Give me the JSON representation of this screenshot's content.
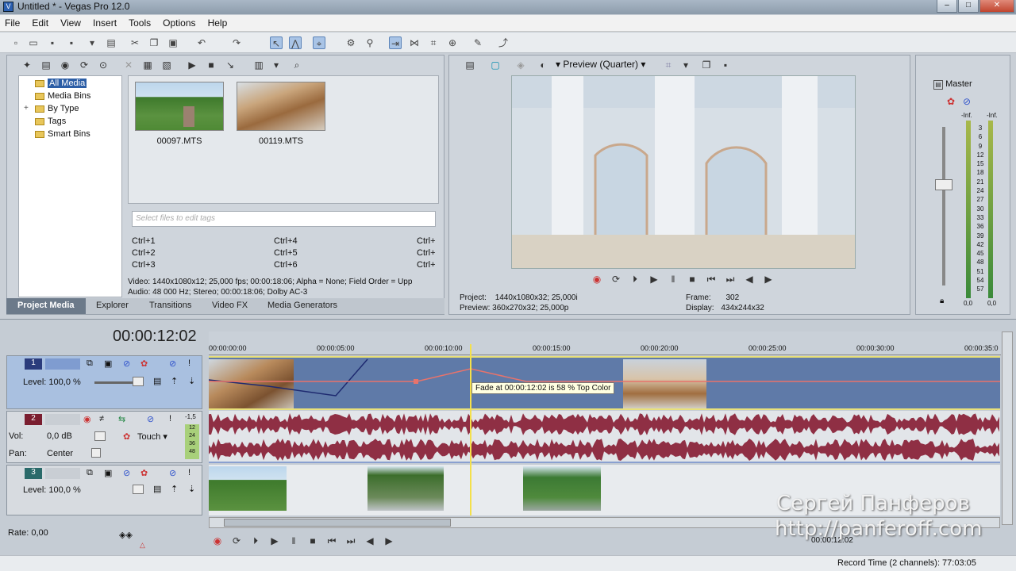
{
  "window": {
    "title": "Untitled * - Vegas Pro 12.0",
    "app_icon": "V",
    "min": "–",
    "max": "□",
    "close": "✕"
  },
  "menu": [
    "File",
    "Edit",
    "View",
    "Insert",
    "Tools",
    "Options",
    "Help"
  ],
  "explorer": {
    "tree": [
      "All Media",
      "Media Bins",
      "By Type",
      "Tags",
      "Smart Bins"
    ],
    "tree_expander": "+",
    "media": [
      {
        "name": "00097.MTS"
      },
      {
        "name": "00119.MTS"
      }
    ],
    "tags_placeholder": "Select files to edit tags",
    "shortcuts": [
      [
        "Ctrl+1",
        "Ctrl+4",
        "Ctrl+"
      ],
      [
        "Ctrl+2",
        "Ctrl+5",
        "Ctrl+"
      ],
      [
        "Ctrl+3",
        "Ctrl+6",
        "Ctrl+"
      ]
    ],
    "info1": "Video: 1440x1080x12; 25,000 fps; 00:00:18:06; Alpha = None; Field Order = Upp",
    "info2": "Audio: 48 000 Hz; Stereo; 00:00:18:06; Dolby AC-3",
    "tabs": [
      "Project Media",
      "Explorer",
      "Transitions",
      "Video FX",
      "Media Generators"
    ]
  },
  "preview": {
    "mode": "Preview (Quarter)",
    "project_label": "Project:",
    "project_value": "1440x1080x32; 25,000i",
    "preview_label": "Preview:",
    "preview_value": "360x270x32; 25,000p",
    "frame_label": "Frame:",
    "frame_value": "302",
    "display_label": "Display:",
    "display_value": "434x244x32"
  },
  "master": {
    "label": "Master",
    "inf_left": "-Inf.",
    "inf_right": "-Inf.",
    "scale": [
      "3",
      "6",
      "9",
      "12",
      "15",
      "18",
      "21",
      "24",
      "27",
      "30",
      "33",
      "36",
      "39",
      "42",
      "45",
      "48",
      "51",
      "54",
      "57"
    ],
    "bottom_left": "0,0",
    "bottom_right": "0,0"
  },
  "timeline": {
    "timecode": "00:00:12:02",
    "ruler": [
      "00:00:00:00",
      "00:00:05:00",
      "00:00:10:00",
      "00:00:15:00",
      "00:00:20:00",
      "00:00:25:00",
      "00:00:30:00",
      "00:00:35:0"
    ],
    "tooltip": "Fade at 00:00:12:02 is 58 % Top Color",
    "tracks": [
      {
        "num": "1",
        "level": "Level: 100,0 %"
      },
      {
        "num": "2",
        "vol_label": "Vol:",
        "vol": "0,0 dB",
        "pan_label": "Pan:",
        "pan": "Center",
        "mode": "Touch",
        "meter_top": "-1,5",
        "meter_marks": [
          "12",
          "24",
          "36",
          "48"
        ]
      },
      {
        "num": "3",
        "level": "Level: 100,0 %"
      }
    ],
    "rate": "Rate: 0,00",
    "bottom_timecode": "00:00:12:02"
  },
  "watermark": {
    "name": "Сергей Панферов",
    "url": "http://panferoff.com"
  },
  "status": {
    "record_time": "Record Time (2 channels): 77:03:05"
  },
  "colors": {
    "video_track": "#5f7aa8",
    "audio_wave": "#8f2f44",
    "selection": "#f4e04a",
    "fade_line": "#e8736b"
  }
}
